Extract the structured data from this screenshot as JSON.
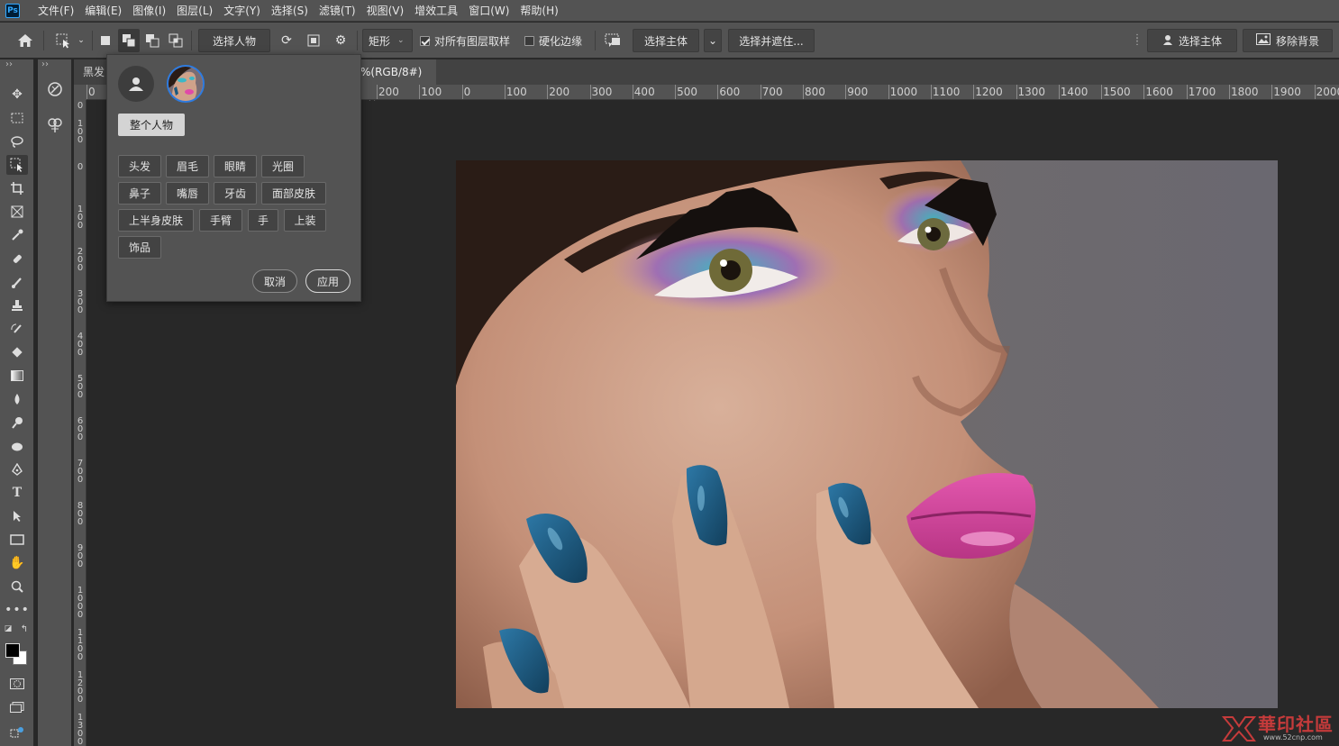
{
  "app": {
    "logo": "Ps",
    "menu": [
      "文件(F)",
      "编辑(E)",
      "图像(I)",
      "图层(L)",
      "文字(Y)",
      "选择(S)",
      "滤镜(T)",
      "视图(V)",
      "增效工具",
      "窗口(W)",
      "帮助(H)"
    ]
  },
  "options": {
    "select_people": "选择人物",
    "shape_mode": "矩形",
    "sample_all_layers": "对所有图层取样",
    "sample_all_layers_checked": true,
    "hard_edge": "硬化边缘",
    "hard_edge_checked": false,
    "select_subject": "选择主体",
    "select_and_mask": "选择并遮住...",
    "select_subject_right": "选择主体",
    "remove_background": "移除背景"
  },
  "tabs": {
    "tab1": "黑发",
    "tab2": "%(RGB/8#)",
    "close": "×"
  },
  "ruler": {
    "h_labels": [
      "0",
      "200",
      "100",
      "0",
      "100",
      "200",
      "300",
      "400",
      "500",
      "600",
      "700",
      "800",
      "900",
      "1000",
      "1100",
      "1200",
      "1300",
      "1400",
      "1500",
      "1600",
      "1700",
      "1800",
      "1900",
      "2000"
    ],
    "v_labels": [
      "0",
      "100",
      "0",
      "100",
      "200",
      "300",
      "400",
      "500",
      "600",
      "700",
      "800",
      "900",
      "1000",
      "1100",
      "1200",
      "1300"
    ]
  },
  "popup": {
    "whole_person": "整个人物",
    "parts": [
      "头发",
      "眉毛",
      "眼睛",
      "光圈",
      "鼻子",
      "嘴唇",
      "牙齿",
      "面部皮肤",
      "上半身皮肤",
      "手臂",
      "手",
      "上装",
      "饰品"
    ],
    "cancel": "取消",
    "apply": "应用"
  },
  "watermark": {
    "text": "華印社區",
    "url": "www.52cnp.com"
  },
  "colors": {
    "ui_bg": "#535353",
    "canvas_bg": "#282828",
    "accent": "#2d7be0",
    "lips": "#d8489c",
    "nails": "#1c5a80"
  }
}
